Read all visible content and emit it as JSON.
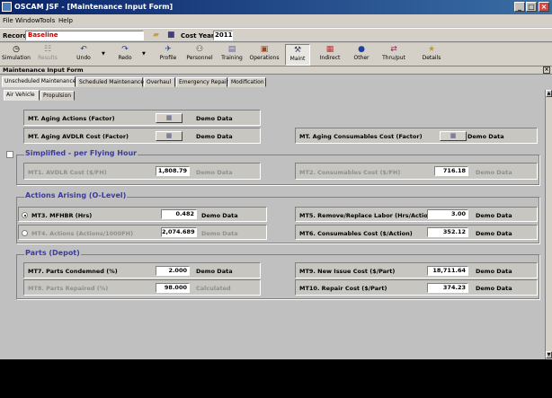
{
  "window": {
    "title": "OSCAM JSF - [Maintenance Input Form]"
  },
  "menu": [
    "File",
    "Window",
    "Tools",
    "Help"
  ],
  "record": {
    "label": "Record",
    "value": "Baseline",
    "cost_year_label": "Cost Year",
    "cost_year": "2011"
  },
  "toolbar": [
    {
      "label": "Simulation",
      "icon": "clock-icon",
      "glyph": "◷"
    },
    {
      "label": "Results",
      "icon": "results-icon",
      "glyph": "☷"
    },
    {
      "label": "Undo",
      "icon": "undo-icon",
      "glyph": "↶"
    },
    {
      "label": "Redo",
      "icon": "redo-icon",
      "glyph": "↷"
    },
    {
      "label": "Profile",
      "icon": "profile-icon",
      "glyph": "✈"
    },
    {
      "label": "Personnel",
      "icon": "personnel-icon",
      "glyph": "⚇"
    },
    {
      "label": "Training",
      "icon": "training-icon",
      "glyph": "▤"
    },
    {
      "label": "Operations",
      "icon": "operations-icon",
      "glyph": "▣"
    },
    {
      "label": "Maint",
      "icon": "wrench-icon",
      "glyph": "⚒"
    },
    {
      "label": "Indirect",
      "icon": "indirect-icon",
      "glyph": "▦"
    },
    {
      "label": "Other",
      "icon": "globe-icon",
      "glyph": "●"
    },
    {
      "label": "Thru/put",
      "icon": "throughput-icon",
      "glyph": "⇄"
    },
    {
      "label": "Details",
      "icon": "details-icon",
      "glyph": "★"
    }
  ],
  "form_title": "Maintenance Input Form",
  "tabs": [
    "Unscheduled Maintenance",
    "Scheduled Maintenance",
    "Overhaul",
    "Emergency Repair",
    "Modification"
  ],
  "subtabs": [
    "Air Vehicle",
    "Propulsion"
  ],
  "aging": {
    "mt1_label": "MT. Aging Actions (Factor)",
    "mt1_src": "Demo Data",
    "mt2_label": "MT. Aging AVDLR Cost (Factor)",
    "mt2_src": "Demo Data",
    "mt3_label": "MT. Aging Consumables Cost (Factor)",
    "mt3_src": "Demo Data"
  },
  "simplified": {
    "title": "Simplified - per Flying Hour",
    "mt1_label": "MT1. AVDLR Cost ($/FH)",
    "mt1_value": "1,808.79",
    "mt1_src": "Demo Data",
    "mt2_label": "MT2. Consumables Cost ($/FH)",
    "mt2_value": "716.18",
    "mt2_src": "Demo Data"
  },
  "actions": {
    "title": "Actions Arising (O-Level)",
    "mt3_label": "MT3. MFHBR (Hrs)",
    "mt3_value": "0.482",
    "mt3_src": "Demo Data",
    "mt4_label": "MT4. Actions (Actions/1000FH)",
    "mt4_value": "2,074.689",
    "mt4_src": "Demo Data",
    "mt5_label": "MT5. Remove/Replace Labor (Hrs/Action)",
    "mt5_value": "3.00",
    "mt5_src": "Demo Data",
    "mt6_label": "MT6. Consumables Cost ($/Action)",
    "mt6_value": "352.12",
    "mt6_src": "Demo Data"
  },
  "parts": {
    "title": "Parts (Depot)",
    "mt7_label": "MT7. Parts Condemned (%)",
    "mt7_value": "2.000",
    "mt7_src": "Demo Data",
    "mt8_label": "MT8. Parts Repaired (%)",
    "mt8_value": "98.000",
    "mt8_src": "Calculated",
    "mt9_label": "MT9. New Issue Cost ($/Part)",
    "mt9_value": "18,711.64",
    "mt9_src": "Demo Data",
    "mt10_label": "MT10. Repair Cost ($/Part)",
    "mt10_value": "374.23",
    "mt10_src": "Demo Data"
  }
}
